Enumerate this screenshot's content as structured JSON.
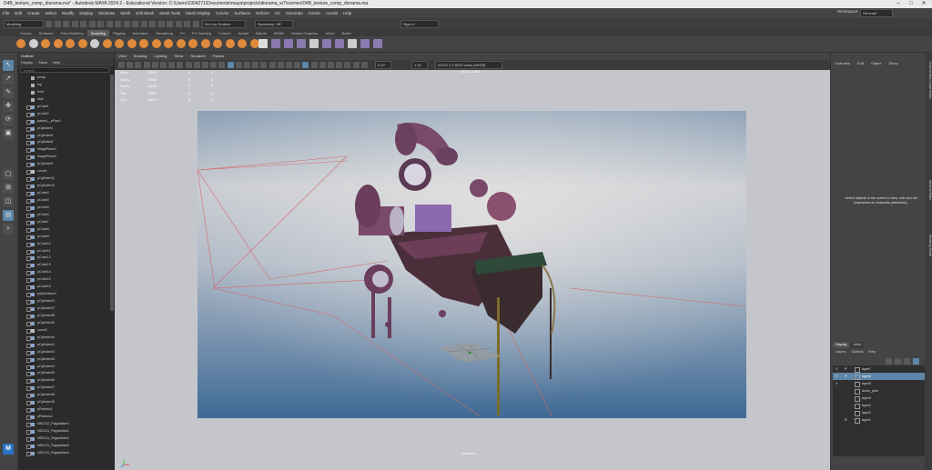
{
  "window": {
    "title": "D4B_texture_comp_diorama.ma* - Autodesk MAYA 2024.2 - Educational Version: C:\\Users\\2304271\\Documents\\maya\\projects\\diorama_w7\\scenes\\D4B_texture_comp_diorama.ma",
    "workspace_label": "Workspace:",
    "workspace_value": "General*"
  },
  "menubar": [
    "File",
    "Edit",
    "Create",
    "Select",
    "Modify",
    "Display",
    "Windows",
    "Mesh",
    "Edit Mesh",
    "Mesh Tools",
    "Mesh Display",
    "Curves",
    "Surfaces",
    "Deform",
    "UV",
    "Generate",
    "Cache",
    "Arnold",
    "Help"
  ],
  "statusline": {
    "mode": "Modeling",
    "live_surface": "No Live Surface",
    "symmetry": "Symmetry: Off",
    "sign_in": "Sign In"
  },
  "shelf_tabs": [
    "Curves",
    "Surfaces",
    "Poly Modeling",
    "Sculpting",
    "Rigging",
    "Animation",
    "Rendering",
    "FX",
    "FX Caching",
    "Custom",
    "Arnold",
    "Bifrost",
    "MASH",
    "Motion Graphics",
    "XGen",
    "Bullet"
  ],
  "shelf_active": "Sculpting",
  "outliner": {
    "title": "Outliner",
    "menu": [
      "Display",
      "Show",
      "Help"
    ],
    "search_placeholder": "Search...",
    "items": [
      "persp",
      "top",
      "front",
      "side",
      "pCube1",
      "pCube2",
      "pasted__pPipe1",
      "pCylinder4",
      "pCylinder6",
      "pCylinder8",
      "imagePlane1",
      "imagePlane2",
      "pCylinder9",
      "curve1",
      "pCylinder11",
      "pCylinder12",
      "pCube3",
      "pCube4",
      "pCube5",
      "pCube6",
      "pCube7",
      "pCube8",
      "pCube9",
      "pCube10",
      "pCube11",
      "pCube12",
      "pCube13",
      "pCube14",
      "pCube15",
      "pCube16",
      "polySurface1",
      "pCylinder24",
      "pCylinder37",
      "pCylinder38",
      "pCylinder39",
      "curve2",
      "pCylinder40",
      "pCylinder41",
      "pCylinder42",
      "pCylinder43",
      "pCylinder44",
      "pCylinder45",
      "pCylinder46",
      "pCylinder47",
      "pCylinder48",
      "pCylinder49",
      "pPlatonic1",
      "pPlatonic2",
      "NEDJ12_Pagvaldian1",
      "NEDJ11_Pagvaldian1",
      "NEDJ11_Pagvaldian2",
      "NEDJ11_Pagvaldian3",
      "NEDJ11_Pagvaldian4"
    ]
  },
  "viewport": {
    "menu": [
      "View",
      "Shading",
      "Lighting",
      "Show",
      "Renderer",
      "Panels"
    ],
    "hud_rows": [
      {
        "label": "Verts:",
        "a": "12290",
        "b": "0",
        "c": "0"
      },
      {
        "label": "Edges:",
        "a": "24468",
        "b": "0",
        "c": "0"
      },
      {
        "label": "Faces:",
        "a": "12238",
        "b": "0",
        "c": "0"
      },
      {
        "label": "Tris:",
        "a": "23990",
        "b": "0",
        "c": "0"
      },
      {
        "label": "UVs:",
        "a": "16872",
        "b": "0",
        "c": "0"
      }
    ],
    "resolution": "1920 x 1080",
    "camera": "camera1",
    "near": "0.00",
    "far": "1.00",
    "color_space": "ACES 1.0 SDR-video (sRGB)"
  },
  "channelbox": {
    "menu": [
      "Channels",
      "Edit",
      "Object",
      "Show"
    ],
    "empty_message": "Select objects in the scene to view, edit and set keyframes on channels (attributes)."
  },
  "layers": {
    "tabs": [
      "Display",
      "Anim"
    ],
    "active_tab": "Display",
    "menu": [
      "Layers",
      "Options",
      "Help"
    ],
    "items": [
      {
        "v": "V",
        "p": "P",
        "name": "layer7",
        "selected": false
      },
      {
        "v": "V",
        "p": "P",
        "name": "layer6",
        "selected": true
      },
      {
        "v": "V",
        "p": "",
        "name": "layer5",
        "selected": false
      },
      {
        "v": "",
        "p": "",
        "name": "dome_pink",
        "selected": false
      },
      {
        "v": "",
        "p": "",
        "name": "layer4",
        "selected": false
      },
      {
        "v": "",
        "p": "",
        "name": "layer3",
        "selected": false
      },
      {
        "v": "",
        "p": "",
        "name": "layer2",
        "selected": false
      },
      {
        "v": "",
        "p": "R",
        "name": "layer1",
        "selected": false
      }
    ]
  },
  "right_strip": [
    "Channel Box / Layer Editor",
    "Attribute Editor",
    "Modeling Toolkit"
  ],
  "toolbox_logo": "M"
}
